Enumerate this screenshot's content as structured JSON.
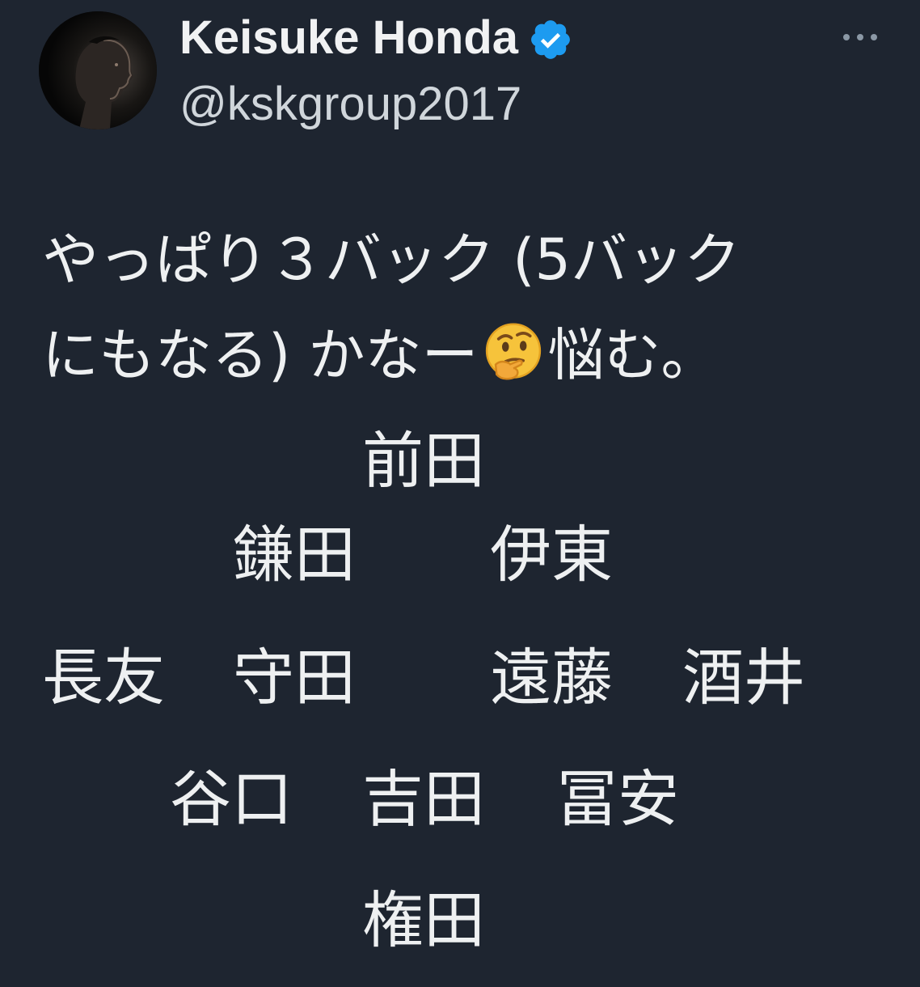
{
  "author": {
    "name": "Keisuke Honda",
    "handle": "@kskgroup2017",
    "verified": true
  },
  "more_icon": "more-horizontal-icon",
  "tweet": {
    "line1": "やっぱり３バック (5バック",
    "line2_before": "にもなる) かなー",
    "emoji": "thinking-face-emoji",
    "line2_after": "悩む。"
  },
  "formation": {
    "forward": "前田",
    "attacking_mid_left": "鎌田",
    "attacking_mid_right": "伊東",
    "wing_back_left": "長友",
    "central_mid_left": "守田",
    "central_mid_right": "遠藤",
    "wing_back_right": "酒井",
    "center_back_left": "谷口",
    "center_back_middle": "吉田",
    "center_back_right": "冨安",
    "goalkeeper": "権田"
  },
  "colors": {
    "background": "#1e2530",
    "text": "#eef0f1",
    "handle": "#d0d6db",
    "verified_badge": "#1d9bf0",
    "more_icon": "#8b98a5"
  }
}
